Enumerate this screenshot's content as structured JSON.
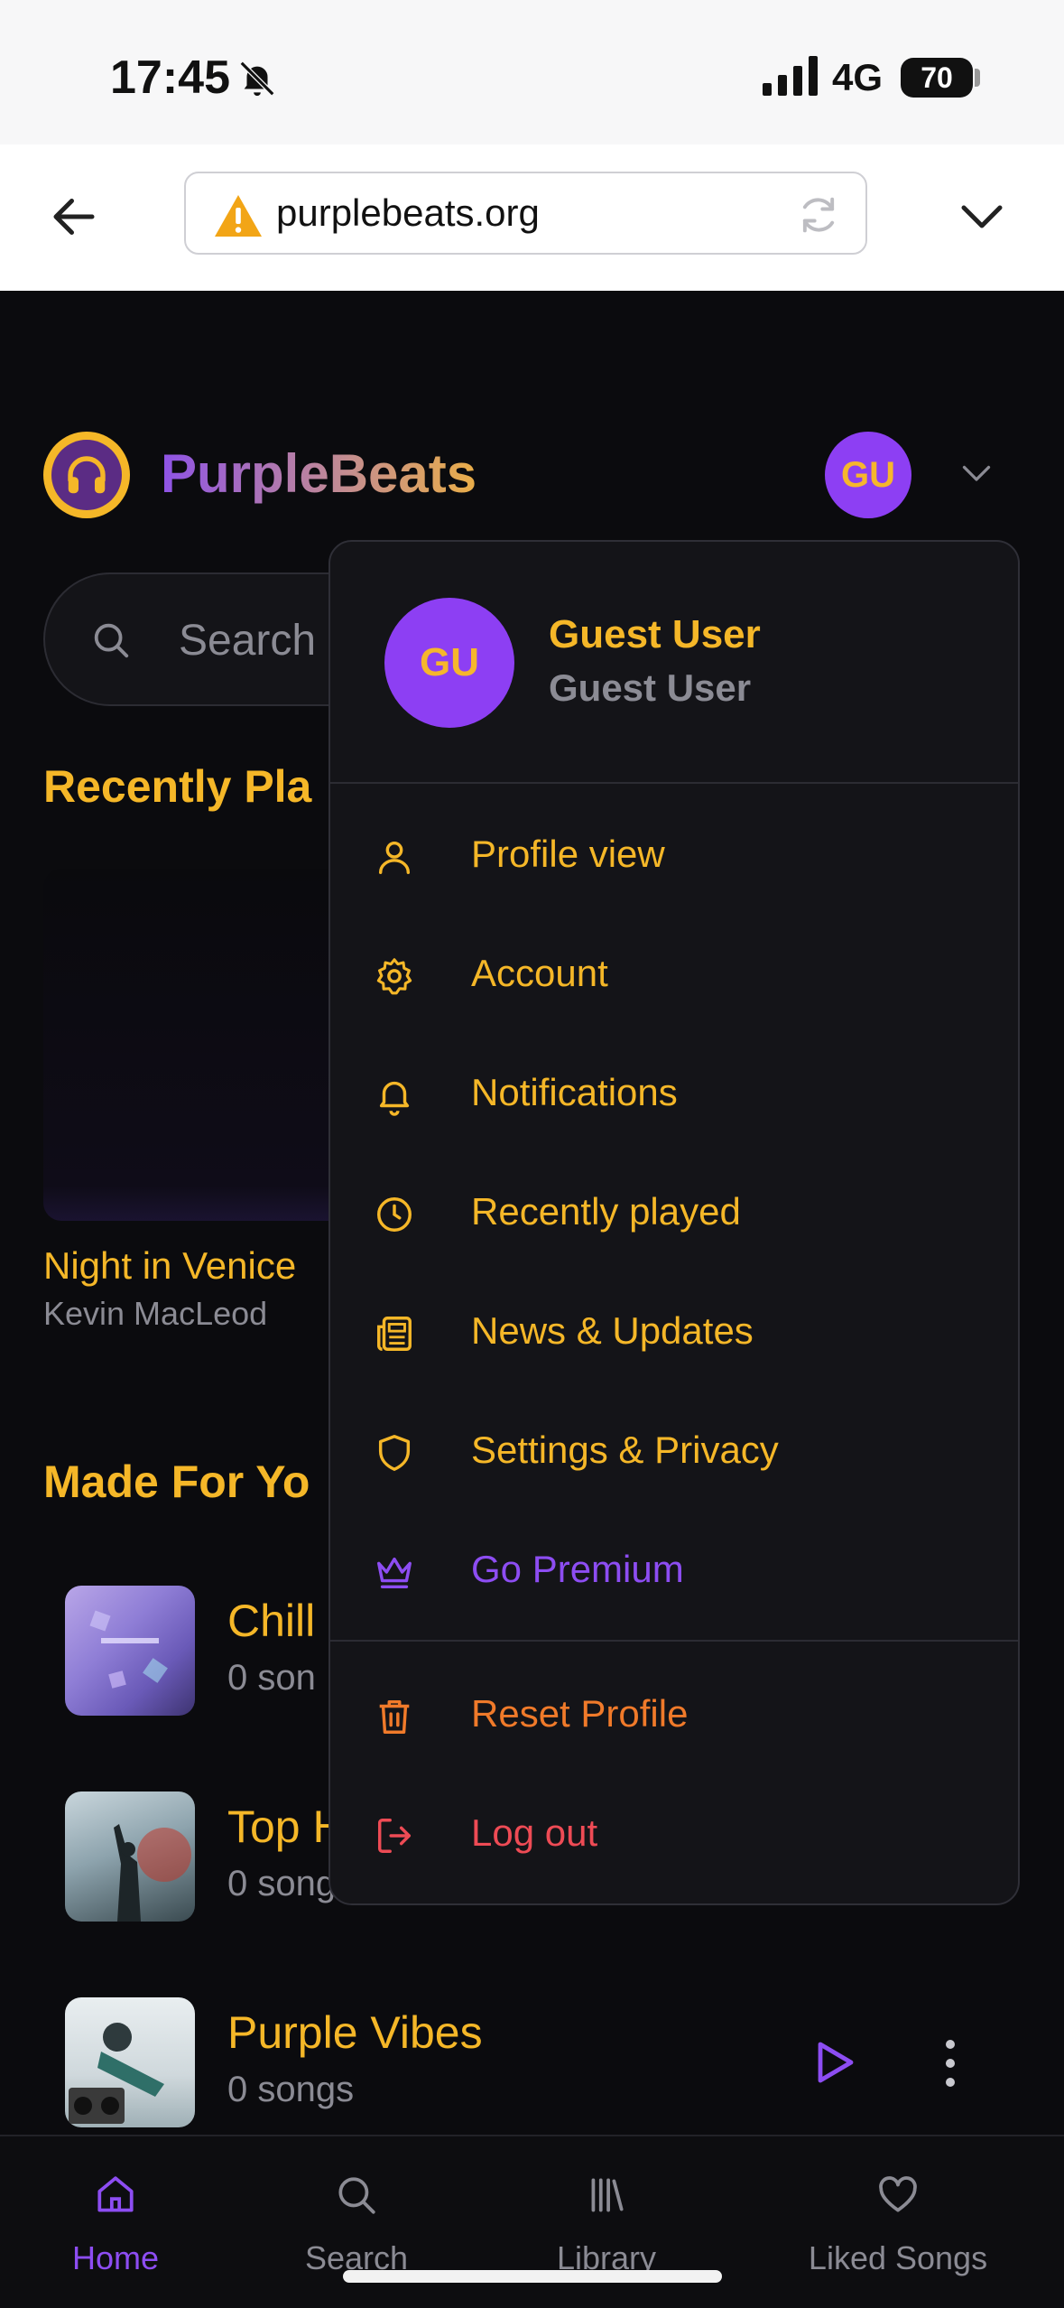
{
  "status_bar": {
    "time": "17:45",
    "network": "4G",
    "battery": "70"
  },
  "browser": {
    "url": "purplebeats.org"
  },
  "app": {
    "brand": "PurpleBeats",
    "avatar_initials": "GU"
  },
  "search": {
    "placeholder": "Search"
  },
  "recently_played": {
    "title": "Recently Pla",
    "track": {
      "title": "Night in Venice",
      "artist": "Kevin MacLeod"
    }
  },
  "made_for_you": {
    "title": "Made For Yo",
    "playlists": [
      {
        "name": "Chill",
        "count": "0 son"
      },
      {
        "name": "Top H",
        "count": "0 song"
      },
      {
        "name": "Purple Vibes",
        "count": "0 songs"
      }
    ]
  },
  "menu": {
    "initials": "GU",
    "name": "Guest User",
    "subtitle": "Guest User",
    "items": [
      {
        "label": "Profile view",
        "icon": "user-icon"
      },
      {
        "label": "Account",
        "icon": "gear-icon"
      },
      {
        "label": "Notifications",
        "icon": "bell-icon"
      },
      {
        "label": "Recently played",
        "icon": "clock-icon"
      },
      {
        "label": "News & Updates",
        "icon": "newspaper-icon"
      },
      {
        "label": "Settings & Privacy",
        "icon": "shield-icon"
      },
      {
        "label": "Go Premium",
        "icon": "crown-icon"
      }
    ],
    "danger_items": [
      {
        "label": "Reset Profile",
        "icon": "trash-icon"
      },
      {
        "label": "Log out",
        "icon": "logout-icon"
      }
    ]
  },
  "nav": {
    "items": [
      {
        "label": "Home",
        "icon": "home-icon",
        "active": true
      },
      {
        "label": "Search",
        "icon": "search-icon"
      },
      {
        "label": "Library",
        "icon": "library-icon"
      },
      {
        "label": "Liked Songs",
        "icon": "heart-icon"
      }
    ]
  },
  "colors": {
    "accent": "#f5b728",
    "purple": "#8d3ff3",
    "danger": "#ee4b55",
    "warning": "#f07a2a"
  }
}
